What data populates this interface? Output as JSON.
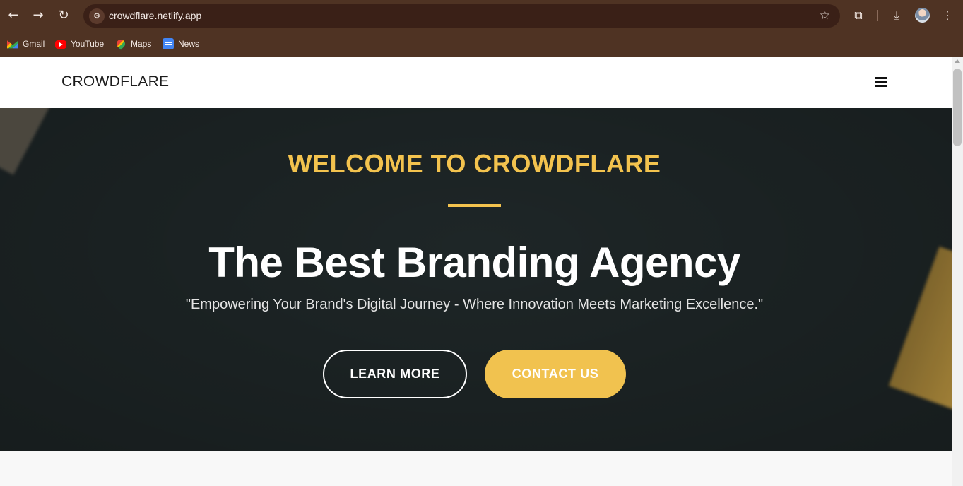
{
  "browser": {
    "url": "crowdflare.netlify.app",
    "bookmarks": [
      {
        "label": "Gmail",
        "icon": "gmail-icon"
      },
      {
        "label": "YouTube",
        "icon": "youtube-icon"
      },
      {
        "label": "Maps",
        "icon": "maps-icon"
      },
      {
        "label": "News",
        "icon": "news-icon"
      }
    ]
  },
  "site": {
    "brand": "CROWDFLARE",
    "hero": {
      "welcome": "WELCOME TO CROWDFLARE",
      "title": "The Best Branding Agency",
      "subtitle": "\"Empowering Your Brand's Digital Journey - Where Innovation Meets Marketing Excellence.\"",
      "learn_more": "LEARN MORE",
      "contact_us": "CONTACT US"
    }
  },
  "colors": {
    "accent": "#f3c34e",
    "hero_bg": "#1e2627",
    "chrome": "#4f3323"
  }
}
